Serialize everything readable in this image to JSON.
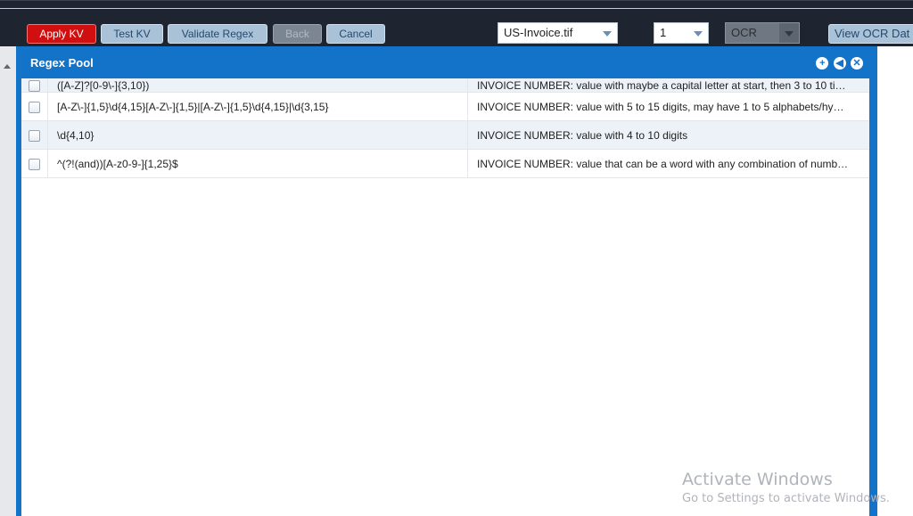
{
  "toolbar": {
    "apply_kv": "Apply KV",
    "test_kv": "Test KV",
    "validate_regex": "Validate Regex",
    "back": "Back",
    "cancel": "Cancel",
    "file_select": "US-Invoice.tif",
    "page_select": "1",
    "mode_select": "OCR",
    "view_ocr": "View OCR Dat"
  },
  "dialog": {
    "title": "Regex Pool",
    "icons": [
      "add-icon",
      "back-icon",
      "close-icon"
    ],
    "rows": [
      {
        "pattern": "([A-Z]?[0-9\\-]{3,10})",
        "description": "INVOICE NUMBER: value with maybe a capital letter at start, then 3 to 10 ti…",
        "checked": false
      },
      {
        "pattern": "[A-Z\\-]{1,5}\\d{4,15}[A-Z\\-]{1,5}|[A-Z\\-]{1,5}\\d{4,15}|\\d{3,15}",
        "description": "INVOICE NUMBER: value with 5 to 15 digits, may have 1 to 5 alphabets/hy…",
        "checked": false
      },
      {
        "pattern": "\\d{4,10}",
        "description": "INVOICE NUMBER: value with 4 to 10 digits",
        "checked": false
      },
      {
        "pattern": "^(?!(and))[A-z0-9-]{1,25}$",
        "description": "INVOICE NUMBER: value that can be a word with any combination of numb…",
        "checked": false
      }
    ]
  },
  "watermark": {
    "title": "Activate Windows",
    "subtitle": "Go to Settings to activate Windows."
  },
  "colors": {
    "apply_button": "#d01010",
    "dialog_header": "#1273c9",
    "toolbar_bg": "#1f2530"
  }
}
